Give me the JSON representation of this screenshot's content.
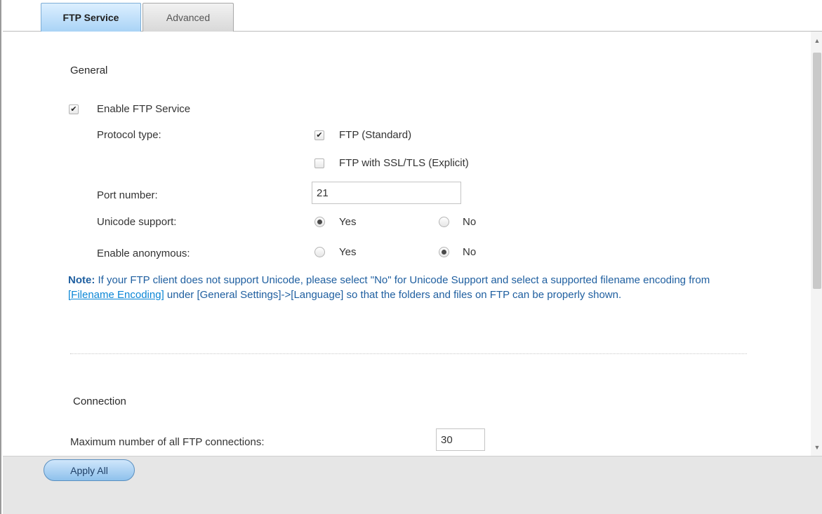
{
  "tabs": [
    {
      "label": "FTP Service",
      "active": true
    },
    {
      "label": "Advanced",
      "active": false
    }
  ],
  "general": {
    "title": "General",
    "enable_ftp": {
      "label": "Enable FTP Service",
      "checked": true
    },
    "protocol": {
      "label": "Protocol type:",
      "options": [
        {
          "label": "FTP (Standard)",
          "checked": true
        },
        {
          "label": "FTP with SSL/TLS (Explicit)",
          "checked": false
        }
      ]
    },
    "port": {
      "label": "Port number:",
      "value": "21"
    },
    "unicode": {
      "label": "Unicode support:",
      "yes": "Yes",
      "no": "No",
      "selected": "Yes"
    },
    "anonymous": {
      "label": "Enable anonymous:",
      "yes": "Yes",
      "no": "No",
      "selected": "No"
    },
    "note": {
      "prefix": "Note:",
      "text1": " If your FTP client does not support Unicode, please select \"No\" for Unicode Support and select a supported filename encoding from ",
      "link": "[Filename Encoding]",
      "text2": " under [General Settings]->[Language] so that the folders and files on FTP can be properly shown."
    }
  },
  "connection": {
    "title": "Connection",
    "max_connections": {
      "label": "Maximum number of all FTP connections:",
      "value": "30"
    }
  },
  "footer": {
    "apply_label": "Apply All"
  },
  "icons": {
    "check": "checkmark-icon",
    "scroll_up": "scroll-up-icon",
    "scroll_down": "scroll-down-icon"
  },
  "colors": {
    "note_text": "#1f5fa0",
    "link": "#0a86d6",
    "tab_active": "#a9d3f6",
    "button": "#8ec1ec"
  }
}
